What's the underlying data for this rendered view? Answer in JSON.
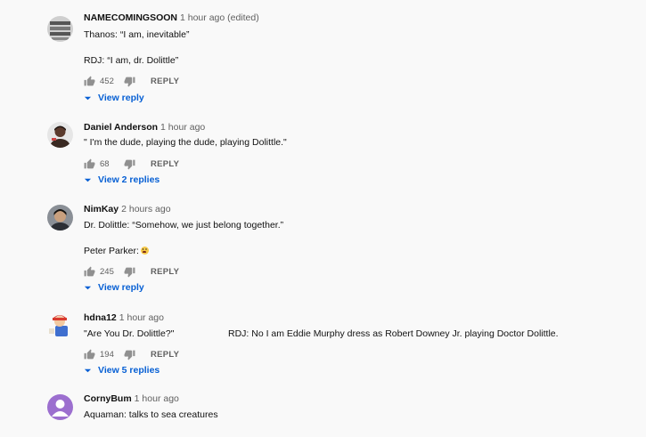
{
  "comments": [
    {
      "author": "NAMECOMINGSOON",
      "time": "1 hour ago (edited)",
      "lines": [
        "Thanos: “I am, inevitable”",
        "",
        "RDJ: “I am, dr. Dolittle”"
      ],
      "likes": "452",
      "reply_label": "REPLY",
      "view_replies": "View reply",
      "avatar_icon": "avatar-icon"
    },
    {
      "author": "Daniel Anderson",
      "time": "1 hour ago",
      "lines": [
        "\" I'm the dude, playing the dude, playing Dolittle.\""
      ],
      "likes": "68",
      "reply_label": "REPLY",
      "view_replies": "View 2 replies",
      "avatar_icon": "avatar-icon"
    },
    {
      "author": "NimKay",
      "time": "2 hours ago",
      "lines": [
        "Dr. Dolittle: “Somehow, we just belong together.”",
        "",
        "Peter Parker:"
      ],
      "emoji": "scream-emoji",
      "likes": "245",
      "reply_label": "REPLY",
      "view_replies": "View reply",
      "avatar_icon": "avatar-icon"
    },
    {
      "author": "hdna12",
      "time": "1 hour ago",
      "lines": [
        "\"Are You Dr. Dolittle?\""
      ],
      "second_text": "RDJ: No I am Eddie Murphy dress as Robert Downey Jr. playing Doctor Dolittle.",
      "likes": "194",
      "reply_label": "REPLY",
      "view_replies": "View 5 replies",
      "avatar_icon": "avatar-icon"
    },
    {
      "author": "CornyBum",
      "time": "1 hour ago",
      "lines": [
        "Aquaman: talks to sea creatures"
      ],
      "avatar_icon": "default-avatar-icon",
      "avatar_color": "#9c6fcf"
    }
  ],
  "colors": {
    "link": "#065fd4",
    "meta": "#606060",
    "background": "#f9f9f9"
  }
}
